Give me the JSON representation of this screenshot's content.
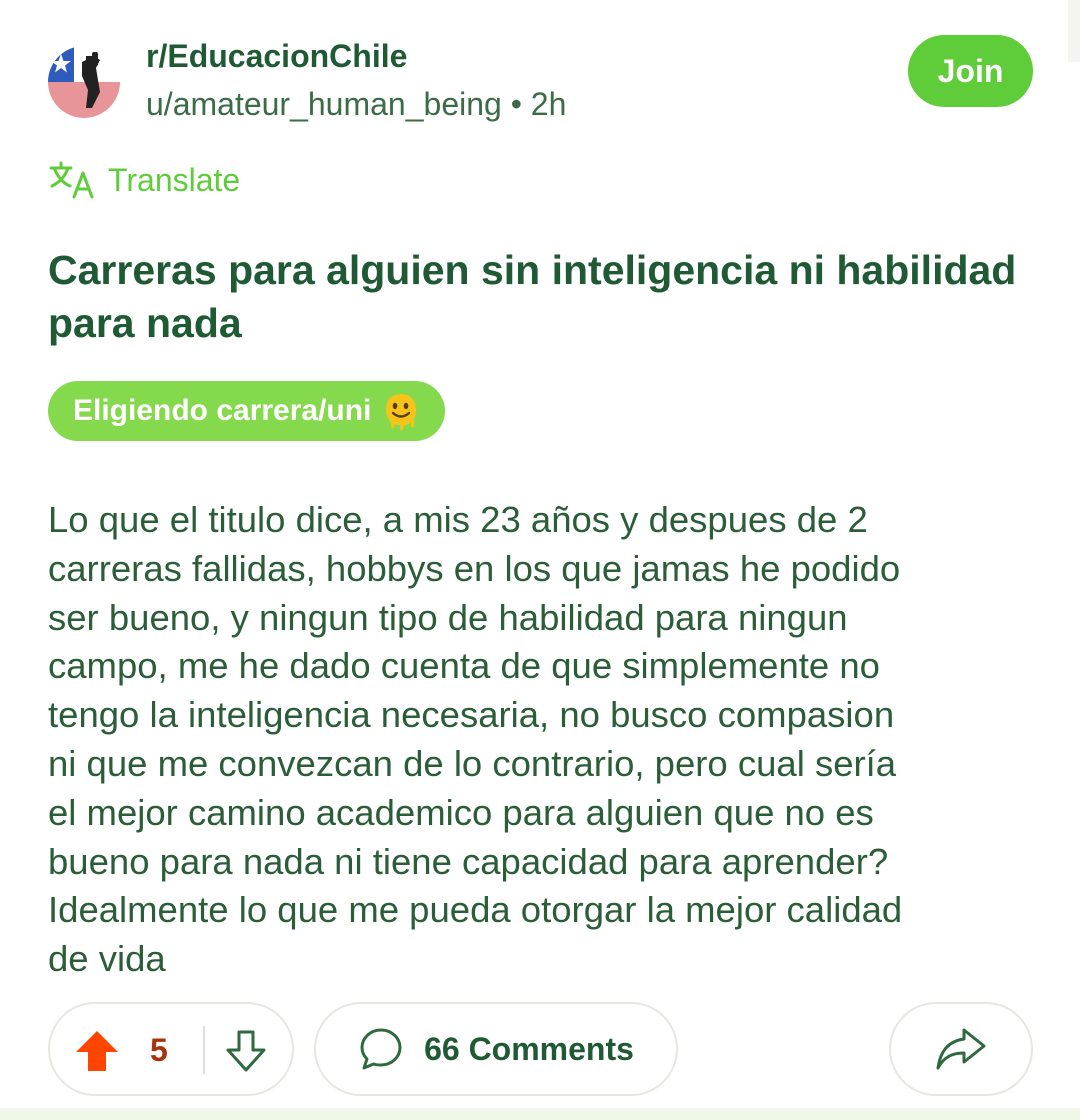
{
  "post": {
    "subreddit": "r/EducacionChile",
    "author": "u/amateur_human_being",
    "separator": "•",
    "age": "2h",
    "join_label": "Join",
    "translate_label": "Translate",
    "title": "Carreras para alguien sin inteligencia ni habilidad para nada",
    "flair": "Eligiendo carrera/uni",
    "body_lines": [
      "Lo que el titulo dice, a mis 23 años y despues de 2",
      "carreras fallidas, hobbys en los que jamas he podido",
      "ser bueno, y ningun tipo de habilidad para ningun",
      "campo, me he dado cuenta de que simplemente no",
      "tengo la inteligencia necesaria, no busco compasion",
      "ni que me convezcan de lo contrario, pero cual sería",
      "el mejor camino academico para alguien que no es",
      "bueno para nada ni tiene capacidad para aprender?",
      "Idealmente lo que me pueda otorgar la mejor calidad",
      "de vida"
    ]
  },
  "actions": {
    "vote_count": "5",
    "comments_label": "66 Comments"
  },
  "colors": {
    "accent": "#5fcc3a",
    "flair_bg": "#85d94c",
    "text_dark_green": "#1f5a35",
    "body_text": "#2a5d38",
    "upvote_active": "#ff4500",
    "vote_count": "#a6330e"
  },
  "icons": {
    "avatar": "subreddit-avatar-chile-flag-fist",
    "translate": "translate-icon",
    "flair_emoji": "melting-face-emoji",
    "upvote": "upvote-arrow-icon",
    "downvote": "downvote-arrow-icon",
    "comments": "comment-bubble-icon",
    "share": "share-arrow-icon"
  }
}
